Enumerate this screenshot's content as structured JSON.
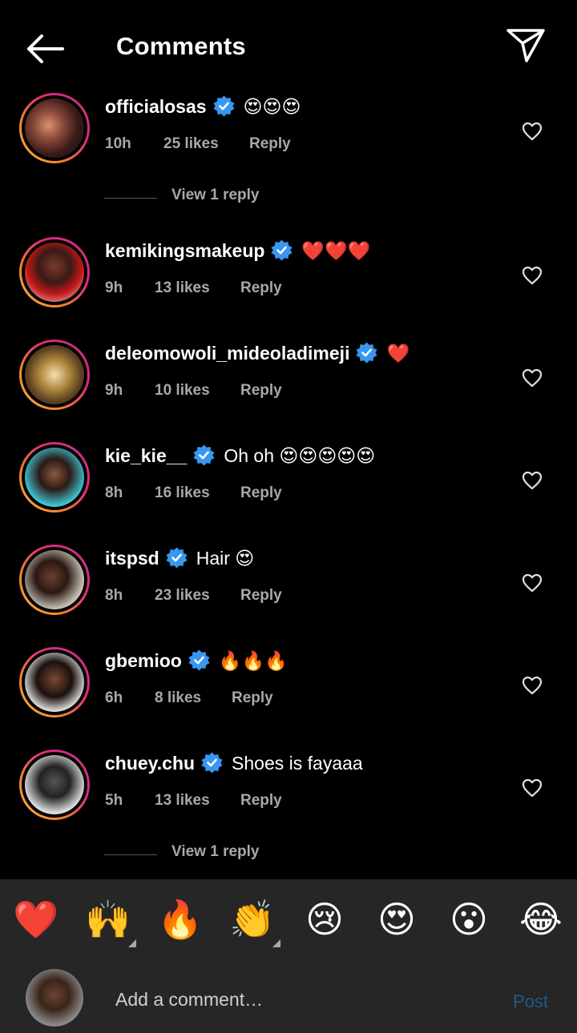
{
  "header": {
    "title": "Comments",
    "back_icon": "arrow-left-icon",
    "send_icon": "paper-plane-icon"
  },
  "comments": [
    {
      "username": "officialosas",
      "verified": true,
      "text": "😍😍😍",
      "time": "10h",
      "likes": "25 likes",
      "reply": "Reply",
      "view_replies": "View 1 reply"
    },
    {
      "username": "kemikingsmakeup",
      "verified": true,
      "text": "❤️❤️❤️",
      "time": "9h",
      "likes": "13 likes",
      "reply": "Reply"
    },
    {
      "username": "deleomowoli_mideoladimeji",
      "verified": true,
      "text": "❤️",
      "time": "9h",
      "likes": "10 likes",
      "reply": "Reply"
    },
    {
      "username": "kie_kie__",
      "verified": true,
      "text": "Oh oh 😍😍😍😍😍",
      "time": "8h",
      "likes": "16 likes",
      "reply": "Reply"
    },
    {
      "username": "itspsd",
      "verified": true,
      "text": "Hair 😍",
      "time": "8h",
      "likes": "23 likes",
      "reply": "Reply"
    },
    {
      "username": "gbemioo",
      "verified": true,
      "text": "🔥🔥🔥",
      "time": "6h",
      "likes": "8 likes",
      "reply": "Reply"
    },
    {
      "username": "chuey.chu",
      "verified": true,
      "text": "Shoes is fayaaa",
      "time": "5h",
      "likes": "13 likes",
      "reply": "Reply",
      "view_replies": "View 1 reply"
    }
  ],
  "quick_reactions": [
    "❤️",
    "🙌",
    "🔥",
    "👏",
    "😢",
    "😍",
    "😮",
    "😂"
  ],
  "composer": {
    "placeholder": "Add a comment…",
    "post_label": "Post"
  },
  "colors": {
    "background": "#000000",
    "secondary_text": "#a8a8a8",
    "verified_blue": "#3897f0",
    "post_disabled": "#1f5a8a",
    "bottom_bar": "#262626"
  }
}
